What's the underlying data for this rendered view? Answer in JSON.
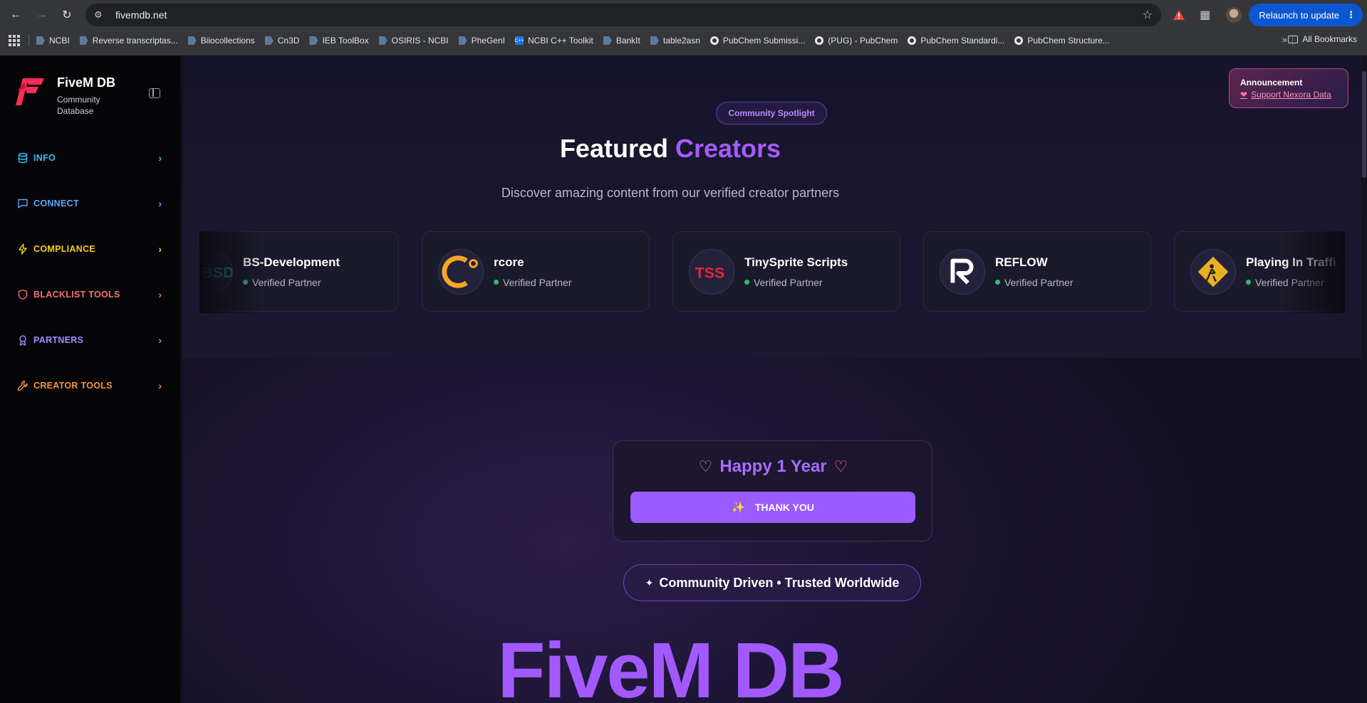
{
  "browser": {
    "url": "fivemdb.net",
    "relaunch_label": "Relaunch to update",
    "bookmarks": [
      {
        "label": "NCBI",
        "icon": "doc-icon"
      },
      {
        "label": "Reverse transcriptas...",
        "icon": "doc-icon"
      },
      {
        "label": "Biiocollections",
        "icon": "doc-icon"
      },
      {
        "label": "Cn3D",
        "icon": "doc-icon"
      },
      {
        "label": "IEB ToolBox",
        "icon": "doc-icon"
      },
      {
        "label": "OSIRIS - NCBI",
        "icon": "doc-icon"
      },
      {
        "label": "PheGenI",
        "icon": "doc-icon"
      },
      {
        "label": "NCBI C++ Toolkit",
        "icon": "cpp-icon"
      },
      {
        "label": "BankIt",
        "icon": "doc-icon"
      },
      {
        "label": "table2asn",
        "icon": "doc-icon"
      },
      {
        "label": "PubChem Submissi...",
        "icon": "pubchem-icon"
      },
      {
        "label": "(PUG) - PubChem",
        "icon": "pubchem-icon"
      },
      {
        "label": "PubChem Standardi...",
        "icon": "pubchem-icon"
      },
      {
        "label": "PubChem Structure...",
        "icon": "pubchem-icon"
      }
    ],
    "all_bookmarks_label": "All Bookmarks"
  },
  "sidebar": {
    "title": "FiveM DB",
    "subtitle": "Community Database",
    "items": [
      {
        "label": "INFO",
        "color": "#38bdf8",
        "icon": "database-icon"
      },
      {
        "label": "CONNECT",
        "color": "#60a5fa",
        "icon": "chat-icon"
      },
      {
        "label": "COMPLIANCE",
        "color": "#facc15",
        "icon": "bolt-icon"
      },
      {
        "label": "BLACKLIST TOOLS",
        "color": "#f87171",
        "icon": "shield-icon"
      },
      {
        "label": "PARTNERS",
        "color": "#a78bfa",
        "icon": "award-icon"
      },
      {
        "label": "CREATOR TOOLS",
        "color": "#fb923c",
        "icon": "wrench-icon"
      }
    ]
  },
  "announcement": {
    "title": "Announcement",
    "link": "Support Nexora Data"
  },
  "featured": {
    "pill": "Community Spotlight",
    "title_a": "Featured",
    "title_b": "Creators",
    "subtitle": "Discover amazing content from our verified creator partners",
    "creators": [
      {
        "name": "BS-Development",
        "status": "Verified Partner"
      },
      {
        "name": "rcore",
        "status": "Verified Partner"
      },
      {
        "name": "TinySprite Scripts",
        "status": "Verified Partner"
      },
      {
        "name": "REFLOW",
        "status": "Verified Partner"
      },
      {
        "name": "Playing In Traffi",
        "status": "Verified Partner"
      }
    ]
  },
  "hero": {
    "year_title": "Happy 1 Year",
    "thank_label": "THANK YOU",
    "community_label": "Community Driven • Trusted Worldwide",
    "big_title": "FiveM DB"
  },
  "colors": {
    "accent": "#a259ff",
    "brand_red": "#ff2d55",
    "verified": "#2dbf6a"
  }
}
